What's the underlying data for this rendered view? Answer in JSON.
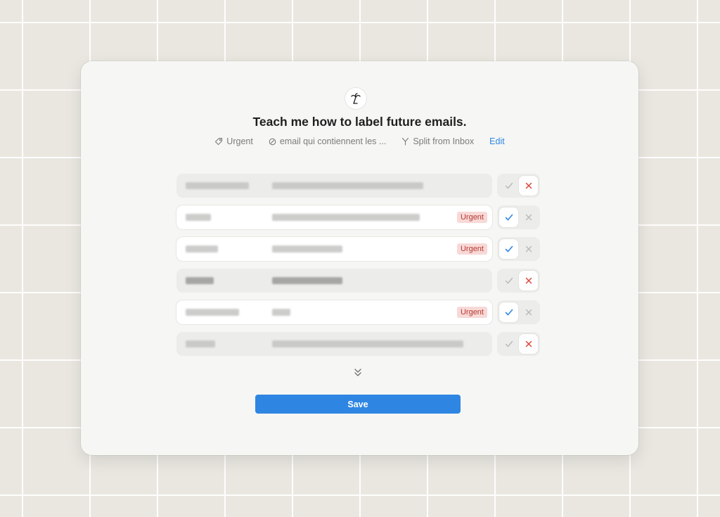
{
  "app": {
    "logo_icon": "palm-tree-icon",
    "title": "Teach me how to label future emails."
  },
  "meta": {
    "label": {
      "icon": "tag-icon",
      "text": "Urgent"
    },
    "condition": {
      "icon": "slash-circle-icon",
      "text": "email qui contiennent les ..."
    },
    "split": {
      "icon": "split-icon",
      "text": "Split from Inbox"
    },
    "edit_label": "Edit"
  },
  "rows": [
    {
      "sender_redacted": true,
      "subject_redacted": true,
      "tag": "",
      "decision": "rejected"
    },
    {
      "sender_redacted": true,
      "subject_redacted": true,
      "tag": "Urgent",
      "decision": "accepted"
    },
    {
      "sender_redacted": true,
      "subject_redacted": true,
      "tag": "Urgent",
      "decision": "accepted"
    },
    {
      "sender_redacted": true,
      "subject_redacted": true,
      "tag": "",
      "decision": "rejected"
    },
    {
      "sender_redacted": true,
      "subject_redacted": true,
      "tag": "Urgent",
      "decision": "accepted"
    },
    {
      "sender_redacted": true,
      "subject_redacted": true,
      "tag": "",
      "decision": "rejected"
    }
  ],
  "expand_icon": "chevrons-down-icon",
  "save_label": "Save",
  "colors": {
    "accent": "#2f86e2",
    "tag_bg": "#f7d9d7",
    "tag_text": "#b93830",
    "reject": "#d9473a",
    "accept": "#2f86e2"
  }
}
